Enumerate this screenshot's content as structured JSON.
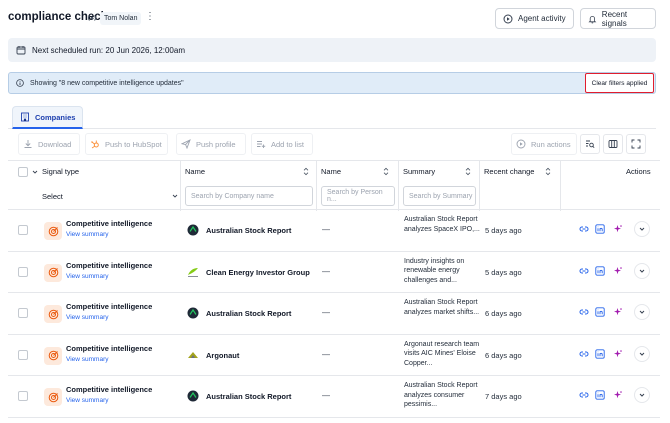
{
  "header": {
    "title": "compliance check",
    "user_badge": "Tom Nolan",
    "agent_activity_label": "Agent activity",
    "recent_signals_label": "Recent signals"
  },
  "schedule": {
    "text": "Next scheduled run: 20 Jun 2026, 12:00am"
  },
  "filter_info": {
    "text": "Showing \"8 new competitive intelligence updates\"",
    "clear_label": "Clear filters applied"
  },
  "tabs": [
    {
      "label": "Companies",
      "active": true
    }
  ],
  "toolbar": {
    "download_label": "Download",
    "push_hubspot_label": "Push to HubSpot",
    "push_profile_label": "Push profile",
    "add_to_list_label": "Add to list",
    "run_actions_label": "Run actions"
  },
  "table": {
    "columns": {
      "signal_type": "Signal type",
      "name_company": "Name",
      "name_person": "Name",
      "summary": "Summary",
      "recent_change": "Recent change",
      "actions": "Actions"
    },
    "filters": {
      "signal_select": "Select",
      "company_search_placeholder": "Search by Company name",
      "person_search_placeholder": "Search by Person n...",
      "summary_search_placeholder": "Search by Summary"
    },
    "rows": [
      {
        "signal_title": "Competitive intelligence",
        "link": "View summary",
        "company": "Australian Stock Report",
        "logo": "asr",
        "person": "—",
        "summary": "Australian Stock Report analyzes SpaceX IPO,...",
        "recent": "5 days ago"
      },
      {
        "signal_title": "Competitive intelligence",
        "link": "View summary",
        "company": "Clean Energy Investor Group",
        "logo": "ceig",
        "person": "—",
        "summary": "Industry insights on renewable energy challenges and...",
        "recent": "5 days ago"
      },
      {
        "signal_title": "Competitive intelligence",
        "link": "View summary",
        "company": "Australian Stock Report",
        "logo": "asr",
        "person": "—",
        "summary": "Australian Stock Report analyzes market shifts...",
        "recent": "6 days ago"
      },
      {
        "signal_title": "Competitive intelligence",
        "link": "View summary",
        "company": "Argonaut",
        "logo": "argonaut",
        "person": "—",
        "summary": "Argonaut research team visits AIC Mines' Eloise Copper...",
        "recent": "6 days ago"
      },
      {
        "signal_title": "Competitive intelligence",
        "link": "View summary",
        "company": "Australian Stock Report",
        "logo": "asr",
        "person": "—",
        "summary": "Australian Stock Report analyzes consumer pessimis...",
        "recent": "7 days ago"
      }
    ]
  },
  "colors": {
    "accent": "#2563eb",
    "info_bg": "#e0ecf8",
    "highlight_border": "#e11d2e",
    "signal_icon_bg": "#fde9dc",
    "signal_icon_fg": "#ea580c",
    "ai_icon": "#a21caf"
  },
  "icons": [
    "broadcast-icon",
    "kebab-icon",
    "agent-activity-icon",
    "bell-icon",
    "calendar-icon",
    "info-icon",
    "companies-icon",
    "download-icon",
    "hubspot-icon",
    "send-icon",
    "add-list-icon",
    "run-actions-icon",
    "search-table-icon",
    "columns-icon",
    "expand-icon",
    "target-icon",
    "link-icon",
    "linkedin-icon",
    "sparkle-icon",
    "chevron-down-icon"
  ]
}
